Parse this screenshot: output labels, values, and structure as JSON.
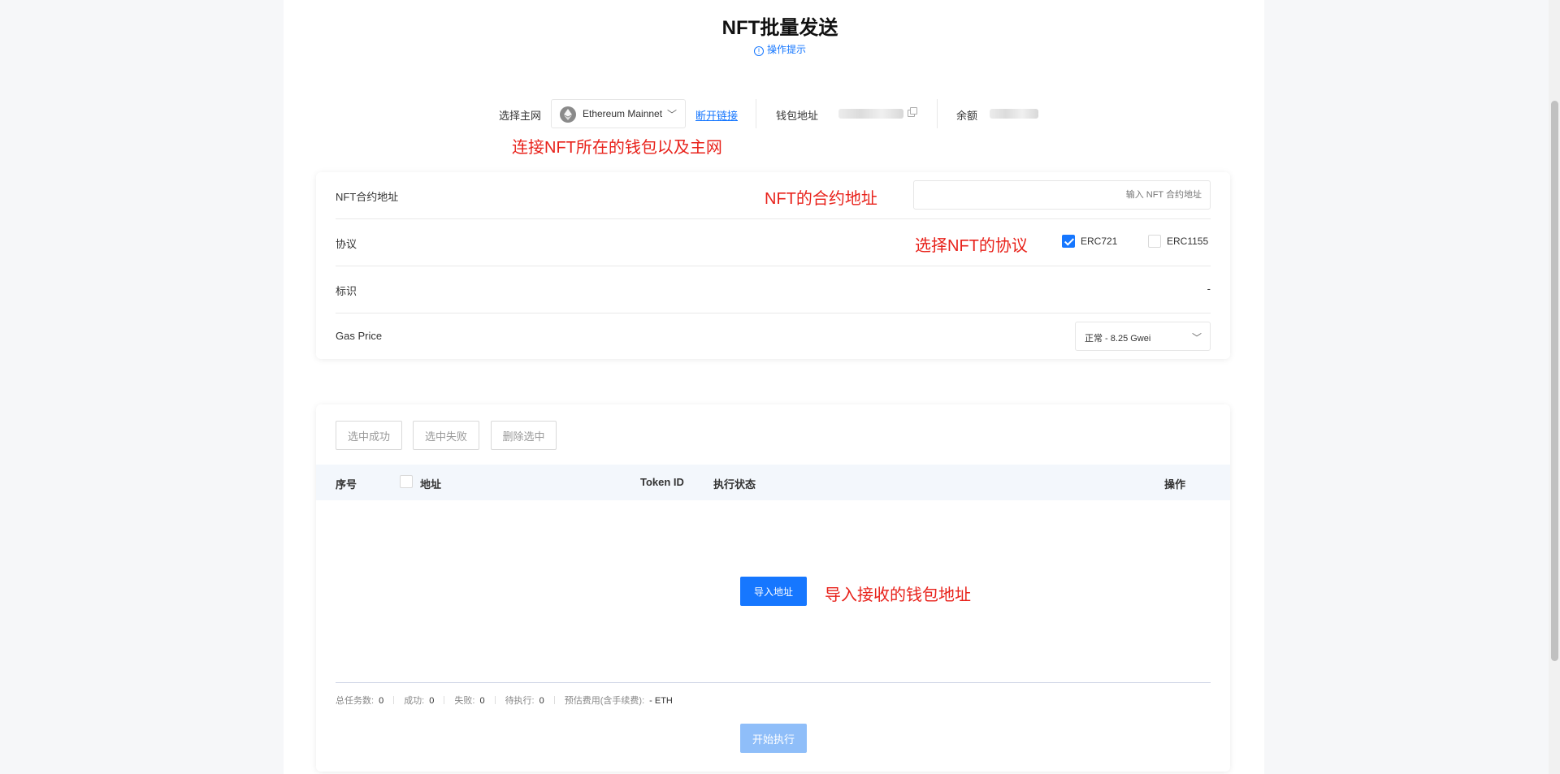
{
  "page": {
    "title": "NFT批量发送",
    "hint": "操作提示",
    "hint_icon": "info-circle-icon"
  },
  "network": {
    "label": "选择主网",
    "selected": "Ethereum Mainnet",
    "disconnect": "断开链接",
    "wallet_label": "钱包地址",
    "balance_label": "余额"
  },
  "annotations": {
    "connect": "连接NFT所在的钱包以及主网",
    "contract": "NFT的合约地址",
    "protocol": "选择NFT的协议",
    "import": "导入接收的钱包地址",
    "color": "#e8221b"
  },
  "form": {
    "contract_label": "NFT合约地址",
    "contract_placeholder": "输入 NFT 合约地址",
    "protocol_label": "协议",
    "protocols": [
      {
        "label": "ERC721",
        "checked": true
      },
      {
        "label": "ERC1155",
        "checked": false
      }
    ],
    "id_label": "标识",
    "id_value": "-",
    "gas_label": "Gas Price",
    "gas_value": "正常 - 8.25 Gwei"
  },
  "table": {
    "buttons": [
      "选中成功",
      "选中失败",
      "删除选中"
    ],
    "headers": {
      "index": "序号",
      "address": "地址",
      "token_id": "Token ID",
      "status": "执行状态",
      "action": "操作"
    },
    "import_button": "导入地址",
    "stats": [
      {
        "label": "总任务数:",
        "value": "0"
      },
      {
        "label": "成功:",
        "value": "0"
      },
      {
        "label": "失败:",
        "value": "0"
      },
      {
        "label": "待执行:",
        "value": "0"
      },
      {
        "label": "预估费用(含手续费):",
        "value": "- ETH"
      }
    ],
    "start_button": "开始执行"
  },
  "colors": {
    "primary": "#1677ff",
    "primary_disabled": "#8fbef9",
    "header_bg": "#f3f7fc"
  }
}
